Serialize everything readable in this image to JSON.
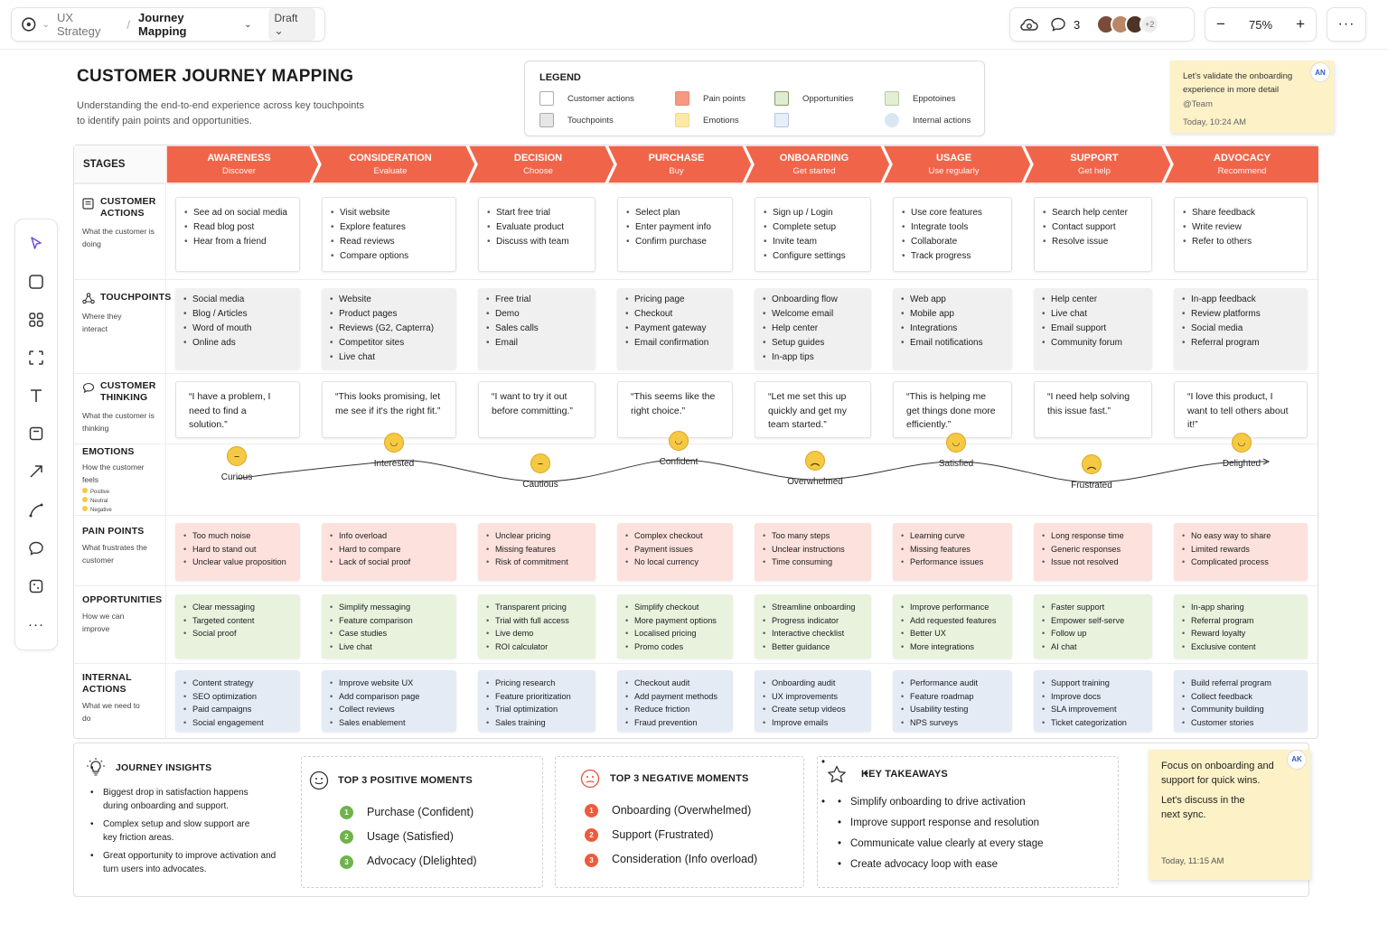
{
  "breadcrumb": {
    "parent": "UX Strategy",
    "current": "Journey Mapping",
    "status": "Draft"
  },
  "collab": {
    "comment_count": "3",
    "extra_users": "+2"
  },
  "zoom": {
    "minus": "−",
    "level": "75%",
    "plus": "+"
  },
  "title": "CUSTOMER JOURNEY MAPPING",
  "subtitle": "Understanding the end-to-end experience across key touchpoints to identify pain points and opportunities.",
  "legend": {
    "title": "LEGEND",
    "items": [
      {
        "label": "Customer actions",
        "color": "#ffffff"
      },
      {
        "label": "Touchpoints",
        "color": "#e6e6e6"
      },
      {
        "label": "Pain points",
        "color": "#f69882"
      },
      {
        "label": "Emotions",
        "color": "#fde8a4"
      },
      {
        "label": "Opportunities",
        "color": "#dfeccf"
      },
      {
        "label": "",
        "color": "#e6eef8"
      },
      {
        "label": "Eppotoines",
        "color": "#e2efd2"
      },
      {
        "label": "Internal actions",
        "color": "#dbe6f3"
      }
    ]
  },
  "note_top": {
    "text": "Let's validate the onboarding experience in more detail",
    "mention": "@Team",
    "time": "Today, 10:24 AM",
    "initials": "AN"
  },
  "stages_label": "STAGES",
  "stages": [
    {
      "name": "AWARENESS",
      "sub": "Discover"
    },
    {
      "name": "CONSIDERATION",
      "sub": "Evaluate"
    },
    {
      "name": "DECISION",
      "sub": "Choose"
    },
    {
      "name": "PURCHASE",
      "sub": "Buy"
    },
    {
      "name": "ONBOARDING",
      "sub": "Get started"
    },
    {
      "name": "USAGE",
      "sub": "Use regularly"
    },
    {
      "name": "SUPPORT",
      "sub": "Get help"
    },
    {
      "name": "ADVOCACY",
      "sub": "Recommend"
    }
  ],
  "rows": {
    "actions": {
      "title": "CUSTOMER ACTIONS",
      "desc": "What the customer is doing"
    },
    "touchpoints": {
      "title": "TOUCHPOINTS",
      "desc": "Where they interact"
    },
    "thinking": {
      "title": "CUSTOMER THINKING",
      "desc": "What the customer is thinking"
    },
    "emotions": {
      "title": "EMOTIONS",
      "desc": "How the customer feels",
      "key": [
        "Positive",
        "Neutral",
        "Negative"
      ]
    },
    "pain": {
      "title": "PAIN POINTS",
      "desc": "What frustrates the customer"
    },
    "opps": {
      "title": "OPPORTUNITIES",
      "desc": "How we can improve"
    },
    "internal": {
      "title": "INTERNAL ACTIONS",
      "desc": "What we need to do"
    }
  },
  "actions": [
    [
      "See ad on social media",
      "Read blog post",
      "Hear from a friend"
    ],
    [
      "Visit website",
      "Explore features",
      "Read reviews",
      "Compare options"
    ],
    [
      "Start free trial",
      "Evaluate product",
      "Discuss with team"
    ],
    [
      "Select plan",
      "Enter payment info",
      "Confirm purchase"
    ],
    [
      "Sign up / Login",
      "Complete setup",
      "Invite team",
      "Configure settings"
    ],
    [
      "Use core features",
      "Integrate tools",
      "Collaborate",
      "Track progress"
    ],
    [
      "Search help center",
      "Contact support",
      "Resolve issue"
    ],
    [
      "Share feedback",
      "Write review",
      "Refer to others"
    ]
  ],
  "touchpoints": [
    [
      "Social media",
      "Blog / Articles",
      "Word of mouth",
      "Online ads"
    ],
    [
      "Website",
      "Product pages",
      "Reviews (G2, Capterra)",
      "Competitor sites",
      "Live chat"
    ],
    [
      "Free trial",
      "Demo",
      "Sales calls",
      "Email"
    ],
    [
      "Pricing page",
      "Checkout",
      "Payment gateway",
      "Email confirmation"
    ],
    [
      "Onboarding flow",
      "Welcome email",
      "Help center",
      "Setup guides",
      "In-app tips"
    ],
    [
      "Web app",
      "Mobile app",
      "Integrations",
      "Email notifications"
    ],
    [
      "Help center",
      "Live chat",
      "Email support",
      "Community forum"
    ],
    [
      "In-app feedback",
      "Review platforms",
      "Social media",
      "Referral program"
    ]
  ],
  "thinking": [
    "“I have a problem, I need to find a solution.”",
    "“This looks promising, let me see if it's the right fit.”",
    "“I want to try it out before committing.”",
    "“This seems like the right choice.”",
    "“Let me set this up quickly and get my team started.”",
    "“This is helping me get things done more efficiently.”",
    "“I need help solving this issue fast.”",
    "“I love this product, I want to tell others about it!”"
  ],
  "emotions": [
    {
      "label": "Curious",
      "sentiment": "neutral"
    },
    {
      "label": "Interested",
      "sentiment": "positive"
    },
    {
      "label": "Cautious",
      "sentiment": "neutral"
    },
    {
      "label": "Confident",
      "sentiment": "positive"
    },
    {
      "label": "Overwhelmed",
      "sentiment": "negative"
    },
    {
      "label": "Satisfied",
      "sentiment": "positive"
    },
    {
      "label": "Frustrated",
      "sentiment": "negative"
    },
    {
      "label": "Delighted",
      "sentiment": "positive"
    }
  ],
  "pain": [
    [
      "Too much noise",
      "Hard to stand out",
      "Unclear value proposition"
    ],
    [
      "Info overload",
      "Hard to compare",
      "Lack of social proof"
    ],
    [
      "Unclear pricing",
      "Missing features",
      "Risk of commitment"
    ],
    [
      "Complex checkout",
      "Payment issues",
      "No local currency"
    ],
    [
      "Too many steps",
      "Unclear instructions",
      "Time consuming"
    ],
    [
      "Learning curve",
      "Missing features",
      "Performance issues"
    ],
    [
      "Long response time",
      "Generic responses",
      "Issue not resolved"
    ],
    [
      "No easy way to share",
      "Limited rewards",
      "Complicated process"
    ]
  ],
  "opps": [
    [
      "Clear messaging",
      "Targeted content",
      "Social proof"
    ],
    [
      "Simplify messaging",
      "Feature comparison",
      "Case studies",
      "Live chat"
    ],
    [
      "Transparent pricing",
      "Trial with full access",
      "Live demo",
      "ROI calculator"
    ],
    [
      "Simplify checkout",
      "More payment options",
      "Localised pricing",
      "Promo codes"
    ],
    [
      "Streamline onboarding",
      "Progress indicator",
      "Interactive checklist",
      "Better guidance"
    ],
    [
      "Improve performance",
      "Add requested features",
      "Better UX",
      "More integrations"
    ],
    [
      "Faster support",
      "Empower self-serve",
      "Follow up",
      "AI chat"
    ],
    [
      "In-app sharing",
      "Referral program",
      "Reward loyalty",
      "Exclusive content"
    ]
  ],
  "internal": [
    [
      "Content strategy",
      "SEO optimization",
      "Paid campaigns",
      "Social engagement"
    ],
    [
      "Improve website UX",
      "Add comparison page",
      "Collect reviews",
      "Sales enablement"
    ],
    [
      "Pricing research",
      "Feature prioritization",
      "Trial optimization",
      "Sales training"
    ],
    [
      "Checkout audit",
      "Add payment methods",
      "Reduce friction",
      "Fraud prevention"
    ],
    [
      "Onboarding audit",
      "UX improvements",
      "Create setup videos",
      "Improve emails"
    ],
    [
      "Performance audit",
      "Feature roadmap",
      "Usability testing",
      "NPS surveys"
    ],
    [
      "Support training",
      "Improve docs",
      "SLA improvement",
      "Ticket categorization"
    ],
    [
      "Build referral program",
      "Collect feedback",
      "Community building",
      "Customer stories"
    ]
  ],
  "insights": {
    "title": "JOURNEY INSIGHTS",
    "items": [
      "Biggest drop in satisfaction happens during onboarding and support.",
      "Complex setup and slow support are key friction areas.",
      "Great opportunity to improve activation and turn users into advocates."
    ]
  },
  "positive": {
    "title": "TOP 3 POSITIVE MOMENTS",
    "items": [
      "Purchase (Confident)",
      "Usage (Satisfied)",
      "Advocacy (Dlelighted)"
    ],
    "color": "#6fb34a"
  },
  "negative": {
    "title": "TOP 3 NEGATIVE MOMENTS",
    "items": [
      "Onboarding (Overwhelmed)",
      "Support (Frustrated)",
      "Consideration (Info overload)"
    ],
    "color": "#ef5a3c"
  },
  "takeaways": {
    "title": "KEY TAKEAWAYS",
    "items": [
      "Simplify onboarding to drive activation",
      "Improve support response and resolution",
      "Communicate value clearly at every stage",
      "Create advocacy loop with ease"
    ]
  },
  "note_bottom": {
    "line1": "Focus on onboarding and support for quick wins.",
    "line2": "Let's discuss in the next sync.",
    "time": "Today, 11:15 AM",
    "initials": "AK"
  },
  "colors": {
    "stage": "#f0654a",
    "accent": "#2d58c7"
  }
}
